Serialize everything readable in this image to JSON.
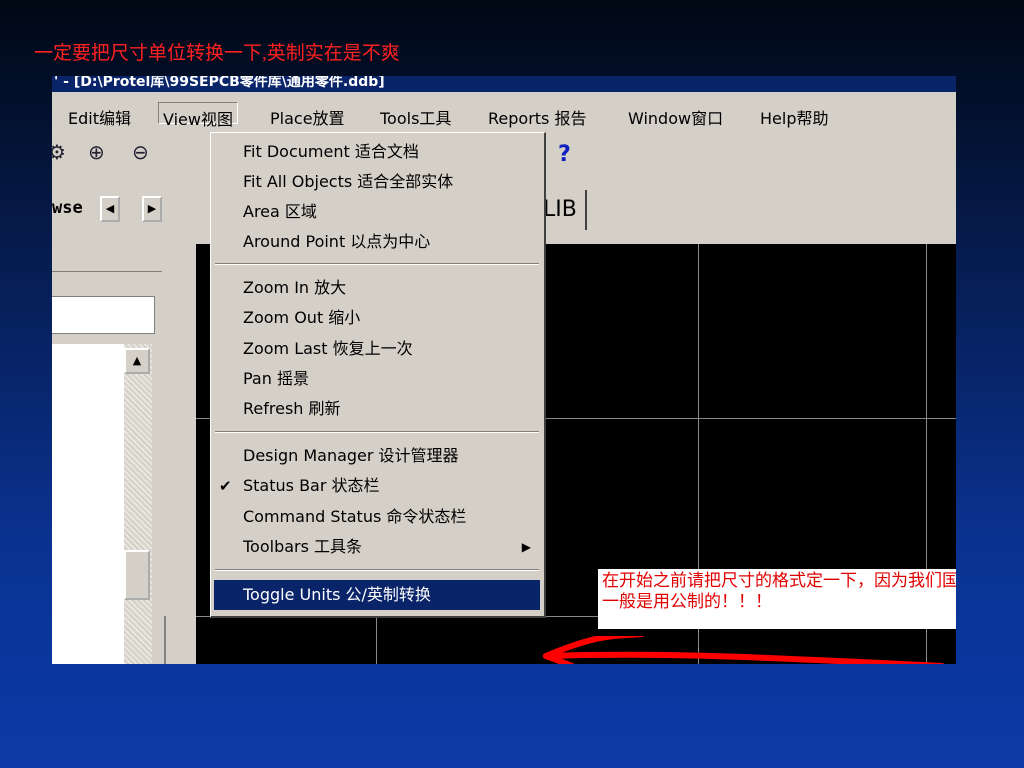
{
  "slide": {
    "title": "一定要把尺寸单位转换一下,英制实在是不爽"
  },
  "window": {
    "title": "' - [D:\\Protel库\\99SEPCB零件库\\通用零件.ddb]"
  },
  "menubar": {
    "items": [
      {
        "id": "edit",
        "label": "Edit编辑"
      },
      {
        "id": "view",
        "label": "View视图"
      },
      {
        "id": "place",
        "label": "Place放置"
      },
      {
        "id": "tools",
        "label": "Tools工具"
      },
      {
        "id": "reports",
        "label": "Reports 报告"
      },
      {
        "id": "window",
        "label": "Window窗口"
      },
      {
        "id": "help",
        "label": "Help帮助"
      }
    ]
  },
  "toolbar": {
    "help_glyph": "?",
    "grid_glyph": "#"
  },
  "panel": {
    "browse_label": "wse",
    "prev_glyph": "◀",
    "next_glyph": "▶",
    "scroll_up_glyph": "▲"
  },
  "document_tab": {
    "label": "零件.LIB"
  },
  "view_menu": {
    "items": [
      {
        "label": "Fit Document 适合文档",
        "checked": false,
        "submenu": false,
        "selected": false
      },
      {
        "label": "Fit All Objects 适合全部实体",
        "checked": false,
        "submenu": false,
        "selected": false
      },
      {
        "label": "Area 区域",
        "checked": false,
        "submenu": false,
        "selected": false
      },
      {
        "label": "Around Point 以点为中心",
        "checked": false,
        "submenu": false,
        "selected": false
      },
      {
        "label": "Zoom In 放大",
        "checked": false,
        "submenu": false,
        "selected": false
      },
      {
        "label": "Zoom Out 缩小",
        "checked": false,
        "submenu": false,
        "selected": false
      },
      {
        "label": "Zoom Last 恢复上一次",
        "checked": false,
        "submenu": false,
        "selected": false
      },
      {
        "label": "Pan 摇景",
        "checked": false,
        "submenu": false,
        "selected": false
      },
      {
        "label": "Refresh 刷新",
        "checked": false,
        "submenu": false,
        "selected": false
      },
      {
        "label": "Design Manager 设计管理器",
        "checked": false,
        "submenu": false,
        "selected": false
      },
      {
        "label": "Status Bar 状态栏",
        "checked": true,
        "submenu": false,
        "selected": false
      },
      {
        "label": "Command Status 命令状态栏",
        "checked": false,
        "submenu": false,
        "selected": false
      },
      {
        "label": "Toolbars 工具条",
        "checked": false,
        "submenu": true,
        "selected": false
      },
      {
        "label": "Toggle Units 公/英制转换",
        "checked": false,
        "submenu": false,
        "selected": true
      }
    ]
  },
  "annotation": {
    "text": "在开始之前请把尺寸的格式定一下，因为我们国人一般是用公制的！！！",
    "color": "#ff0000"
  },
  "colors": {
    "menu_highlight": "#0a246a",
    "canvas": "#000000",
    "accent_red": "#ff2020"
  }
}
